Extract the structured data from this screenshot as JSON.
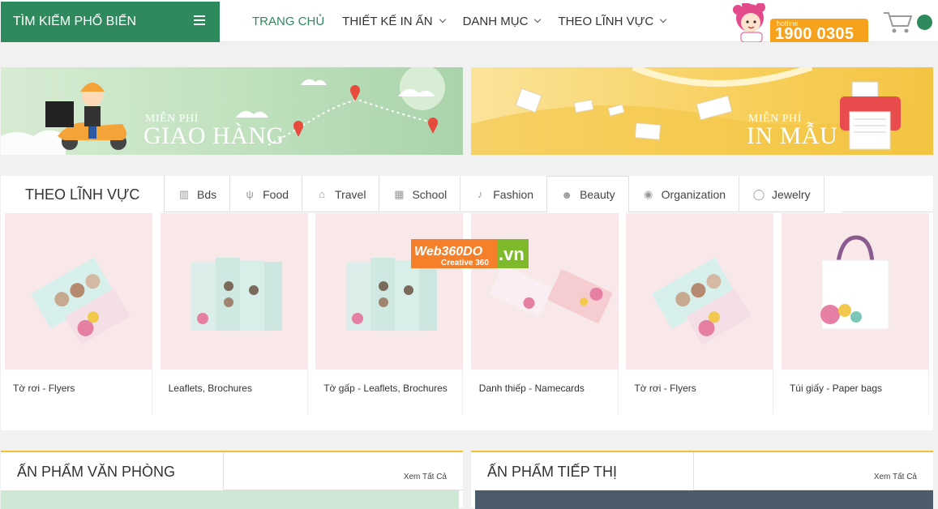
{
  "header": {
    "search_popular": "TÌM KIẾM PHỔ BIẾN",
    "nav": [
      {
        "label": "TRANG CHỦ",
        "active": true,
        "dropdown": false
      },
      {
        "label": "THIẾT KẾ IN ẤN",
        "active": false,
        "dropdown": true
      },
      {
        "label": "DANH MỤC",
        "active": false,
        "dropdown": true
      },
      {
        "label": "THEO LĨNH VỰC",
        "active": false,
        "dropdown": true
      }
    ],
    "hotline_label": "hotline",
    "hotline_number": "1900 0305",
    "accent": "#2e8a5c",
    "hotline_color": "#f6a21d"
  },
  "banners": {
    "left": {
      "small": "MIỄN PHÍ",
      "big": "GIAO HÀNG"
    },
    "right": {
      "small": "MIỄN PHÍ",
      "big": "IN MẪU"
    }
  },
  "sector": {
    "title": "THEO LĨNH VỰC",
    "tabs": [
      {
        "label": "Bds",
        "icon": "building-icon"
      },
      {
        "label": "Food",
        "icon": "utensils-icon"
      },
      {
        "label": "Travel",
        "icon": "temple-icon"
      },
      {
        "label": "School",
        "icon": "school-icon"
      },
      {
        "label": "Fashion",
        "icon": "shoe-icon"
      },
      {
        "label": "Beauty",
        "icon": "beauty-icon",
        "active": true
      },
      {
        "label": "Organization",
        "icon": "globe-icon"
      },
      {
        "label": "Jewelry",
        "icon": "ring-icon"
      }
    ],
    "products": [
      {
        "name": "Tờ rơi - Flyers"
      },
      {
        "name": "Leaflets, Brochures"
      },
      {
        "name": "Tờ gấp - Leaflets, Brochures"
      },
      {
        "name": "Danh thiếp - Namecards"
      },
      {
        "name": "Tờ rơi - Flyers"
      },
      {
        "name": "Túi giấy - Paper bags"
      }
    ]
  },
  "watermark": {
    "brand": "Web360DO",
    "sub": "Creative 360",
    "tld": ".vn"
  },
  "sections": {
    "left": {
      "title": "ẤN PHẨM VĂN PHÒNG",
      "see_all": "Xem Tất Cả"
    },
    "right": {
      "title": "ẤN PHẨM TIẾP THỊ",
      "see_all": "Xem Tất Cả"
    }
  }
}
